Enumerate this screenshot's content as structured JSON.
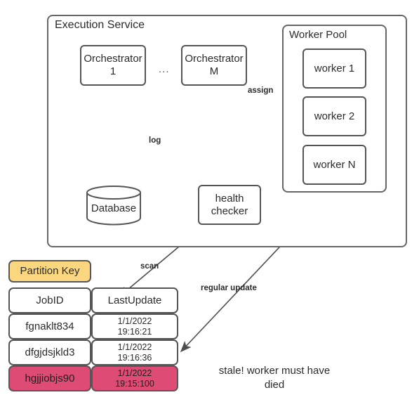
{
  "diagram": {
    "title_visible": false,
    "colors": {
      "stroke": "#555555",
      "container_stroke": "#666666",
      "partition_key_fill": "#FAD77E",
      "stale_row_fill": "#DE4B74",
      "text": "#2b2b2b",
      "background": "#ffffff"
    },
    "containers": [
      {
        "id": "execution-service",
        "label": "Execution Service"
      },
      {
        "id": "worker-pool",
        "label": "Worker Pool"
      }
    ],
    "nodes": [
      {
        "id": "orchestrator-1",
        "line1": "Orchestrator",
        "line2": "1"
      },
      {
        "id": "orchestrator-m",
        "line1": "Orchestrator",
        "line2": "M"
      },
      {
        "id": "worker-1",
        "label": "worker 1"
      },
      {
        "id": "worker-2",
        "label": "worker 2"
      },
      {
        "id": "worker-n",
        "label": "worker N"
      },
      {
        "id": "database",
        "label": "Database"
      },
      {
        "id": "health-checker",
        "line1": "health",
        "line2": "checker"
      }
    ],
    "ellipsis": "...",
    "edge_labels": {
      "assign": "assign",
      "log": "log",
      "scan": "scan",
      "regular_update": "regular update"
    },
    "annotation": {
      "line1": "stale! worker must have",
      "line2": "died"
    }
  },
  "table": {
    "partition_key_label": "Partition Key",
    "columns": [
      "JobID",
      "LastUpdate"
    ],
    "rows": [
      {
        "job_id": "fgnaklt834",
        "last_update_date": "1/1/2022",
        "last_update_time": "19:16:21",
        "stale": false
      },
      {
        "job_id": "dfgjdsjkld3",
        "last_update_date": "1/1/2022",
        "last_update_time": "19:16:36",
        "stale": false
      },
      {
        "job_id": "hgjjiobjs90",
        "last_update_date": "1/1/2022",
        "last_update_time": "19:15:100",
        "stale": true
      }
    ]
  }
}
